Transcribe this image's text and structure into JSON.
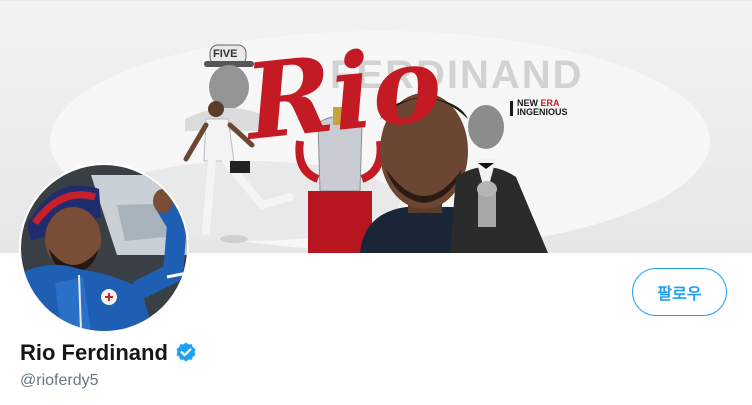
{
  "banner": {
    "surname": "FERDINAND",
    "firstname": "Rio",
    "cap_text": "FIVE",
    "sponsor_line1_a": "NEW ",
    "sponsor_line1_b": "ERA",
    "sponsor_line2": "INGENIOUS",
    "colors": {
      "brand_red": "#c41a24",
      "background": "#ececec"
    }
  },
  "profile": {
    "display_name": "Rio Ferdinand",
    "handle": "@rioferdy5",
    "verified": true,
    "follow_label": "팔로우"
  },
  "icons": {
    "verified": "verified-badge-icon"
  },
  "colors": {
    "accent": "#1da1f2",
    "name": "#14171a",
    "secondary_text": "#657786"
  }
}
